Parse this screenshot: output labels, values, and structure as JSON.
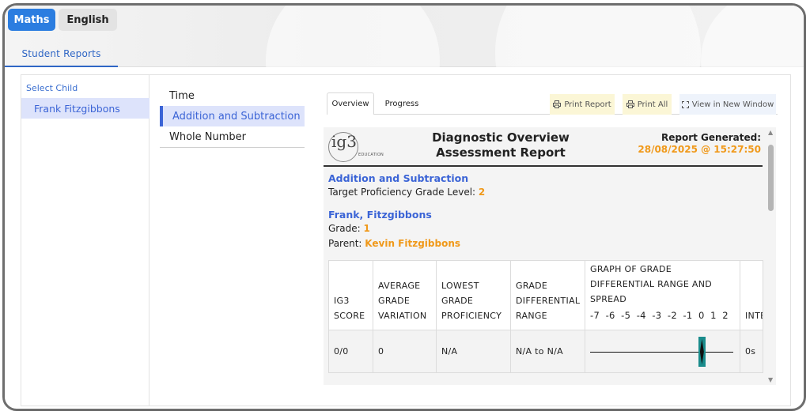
{
  "subjects": [
    {
      "label": "Maths",
      "active": true
    },
    {
      "label": "English",
      "active": false
    }
  ],
  "nav": {
    "student_reports": "Student Reports"
  },
  "sidebar": {
    "select_child_label": "Select Child",
    "children": [
      {
        "name": "Frank Fitzgibbons",
        "selected": true
      }
    ]
  },
  "topics": [
    {
      "label": "Time",
      "active": false
    },
    {
      "label": "Addition and Subtraction",
      "active": true
    },
    {
      "label": "Whole Number",
      "active": false
    }
  ],
  "report_tabs": [
    {
      "label": "Overview",
      "active": true
    },
    {
      "label": "Progress",
      "active": false
    }
  ],
  "actions": {
    "print_report": "Print Report",
    "print_all": "Print All",
    "view_new_window": "View in New Window"
  },
  "report": {
    "logo_text": "ig3",
    "logo_sub": "EDUCATION",
    "title_line1": "Diagnostic Overview",
    "title_line2": "Assessment Report",
    "generated_label": "Report Generated:",
    "generated_value": "28/08/2025 @ 15:27:50",
    "topic": "Addition and Subtraction",
    "target_label": "Target Proficiency Grade Level:",
    "target_value": "2",
    "student_name": "Frank, Fitzgibbons",
    "grade_label": "Grade:",
    "grade_value": "1",
    "parent_label": "Parent:",
    "parent_value": "Kevin Fitzgibbons"
  },
  "table": {
    "headers": {
      "score": "IG3 SCORE",
      "variation": "AVERAGE GRADE VARIATION",
      "lowest": "LOWEST GRADE PROFICIENCY",
      "range": "GRADE DIFFERENTIAL RANGE",
      "graph_line1": "GRAPH OF GRADE",
      "graph_line2": "DIFFERENTIAL RANGE AND",
      "graph_line3": "SPREAD",
      "interaction": "INTERACTION TIME"
    },
    "graph_ticks": [
      "-7",
      "-6",
      "-5",
      "-4",
      "-3",
      "-2",
      "-1",
      "0",
      "1",
      "2"
    ],
    "graph_marker_value": 0,
    "row": {
      "score": "0/0",
      "variation": "0",
      "lowest": "N/A",
      "range": "N/A to N/A",
      "interaction": "0s"
    }
  },
  "colors": {
    "primary_blue": "#2b7de0",
    "link_blue": "#3b64d6",
    "orange": "#f0991a",
    "marker_teal": "#1a8c8c"
  }
}
